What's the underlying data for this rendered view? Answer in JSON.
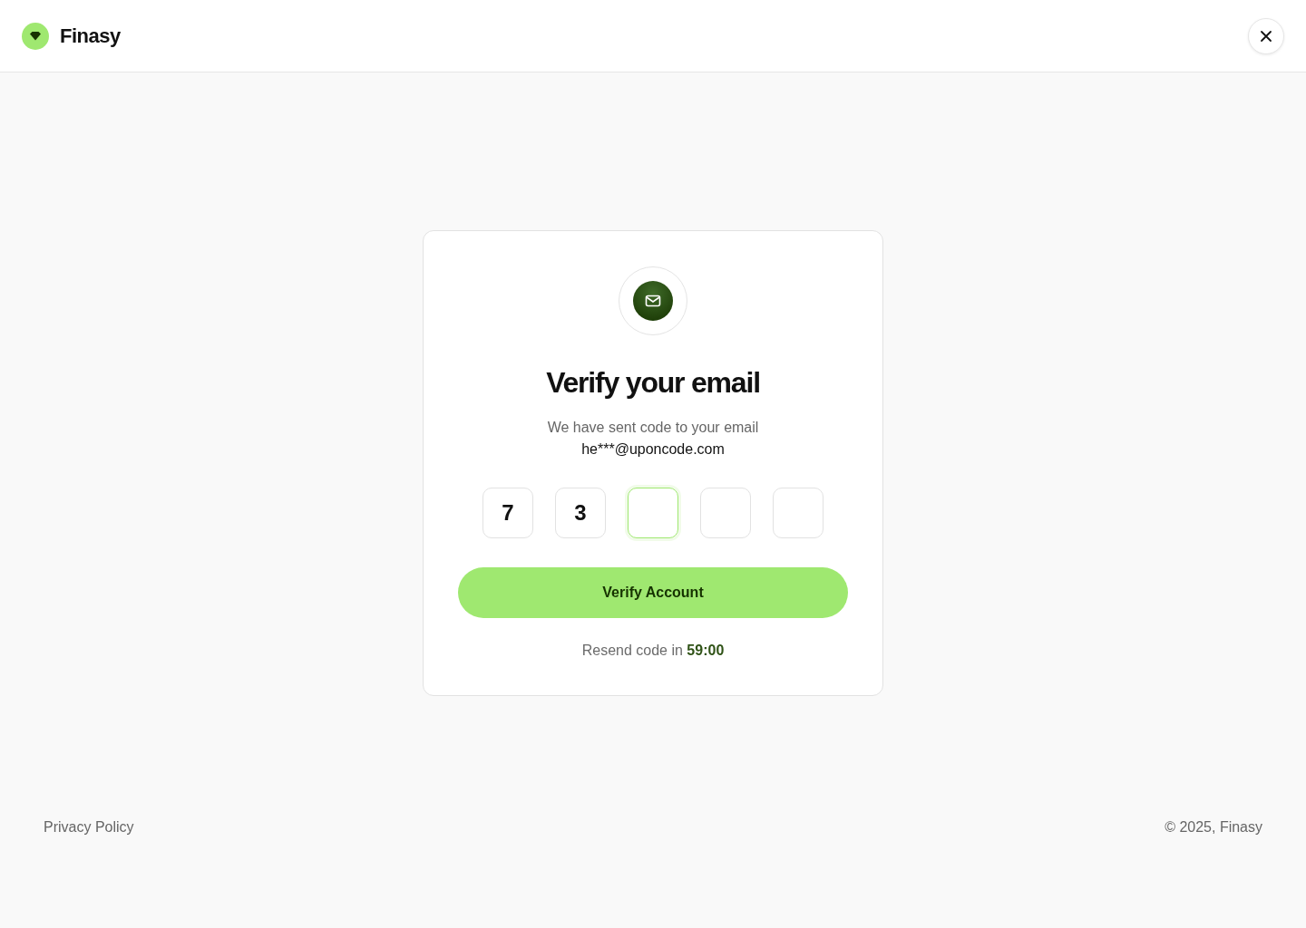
{
  "header": {
    "brand": "Finasy"
  },
  "card": {
    "title": "Verify your email",
    "subtitle": "We have sent code to your email",
    "email": "he***@uponcode.com",
    "code_boxes": [
      {
        "value": "7",
        "focused": false
      },
      {
        "value": "3",
        "focused": false
      },
      {
        "focused": true
      },
      {
        "focused": false
      },
      {
        "focused": false
      }
    ],
    "button": "Verify Account",
    "resend": "Resend code in **59:00**"
  },
  "footer": {
    "link": "Privacy Policy",
    "copyright": "© 2025, Finasy"
  }
}
